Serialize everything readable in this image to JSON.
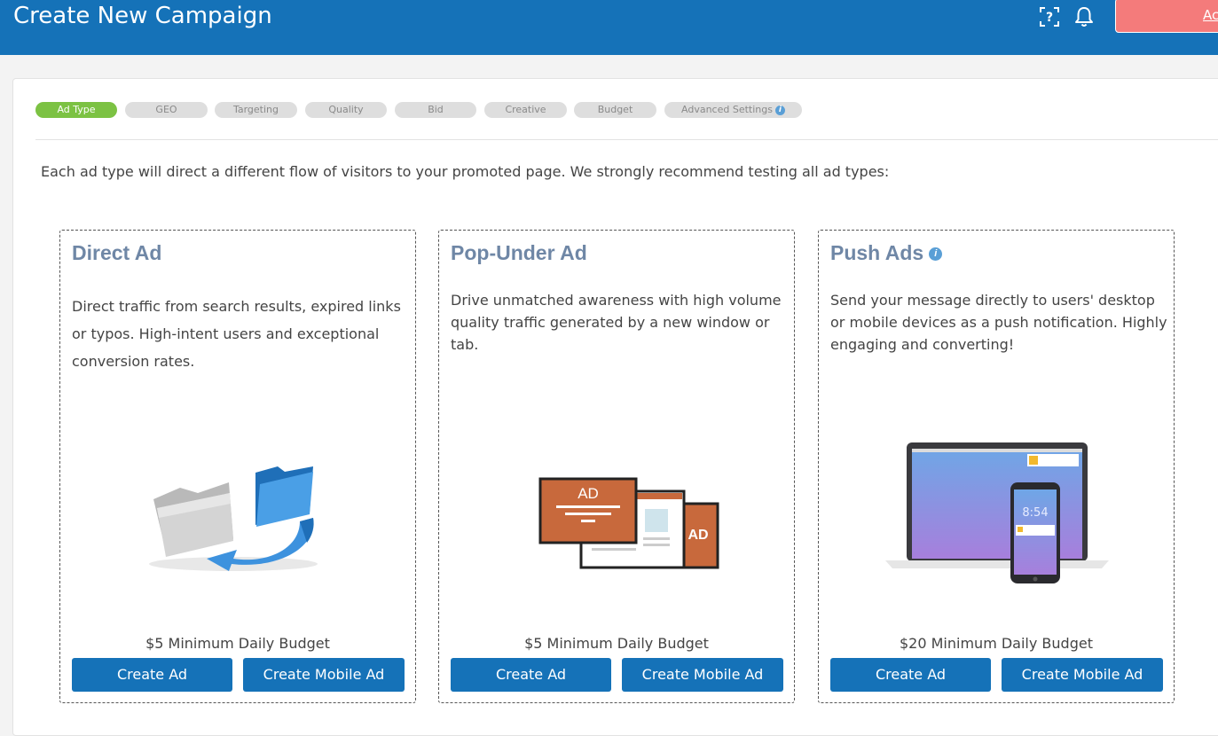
{
  "header": {
    "title": "Create New Campaign",
    "account_label": "Ac"
  },
  "steps": [
    {
      "label": "Ad Type",
      "active": true
    },
    {
      "label": "GEO",
      "active": false
    },
    {
      "label": "Targeting",
      "active": false
    },
    {
      "label": "Quality",
      "active": false
    },
    {
      "label": "Bid",
      "active": false
    },
    {
      "label": "Creative",
      "active": false
    },
    {
      "label": "Budget",
      "active": false
    },
    {
      "label": "Advanced Settings",
      "active": false
    }
  ],
  "intro": "Each ad type will direct a different flow of visitors to your promoted page. We strongly recommend testing all ad types:",
  "cards": [
    {
      "title": "Direct Ad",
      "description": "Direct traffic from search results, expired links or typos. High-intent users and exceptional conversion rates.",
      "budget": "$5 Minimum Daily Budget",
      "create_label": "Create Ad",
      "mobile_label": "Create Mobile Ad"
    },
    {
      "title": "Pop-Under Ad",
      "description": "Drive unmatched awareness with high volume quality traffic generated by a new window or tab.",
      "budget": "$5 Minimum Daily Budget",
      "create_label": "Create Ad",
      "mobile_label": "Create Mobile Ad",
      "illustration_text": "AD"
    },
    {
      "title": "Push Ads",
      "description": "Send your message directly to users' desktop or mobile devices as a push notification. Highly engaging and converting!",
      "budget": "$20 Minimum Daily Budget",
      "create_label": "Create Ad",
      "mobile_label": "Create Mobile Ad",
      "phone_time": "8:54"
    }
  ],
  "colors": {
    "header": "#1572b8",
    "active_step": "#7cc243",
    "button": "#1572b8",
    "card_title": "#6f87a6",
    "account_button": "#f47b7b"
  }
}
